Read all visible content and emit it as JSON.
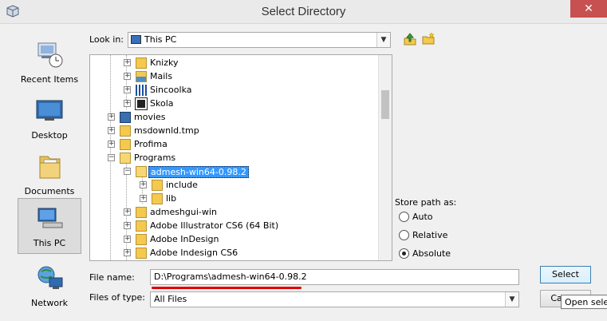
{
  "window": {
    "title": "Select Directory",
    "close_glyph": "✕"
  },
  "sidebar": {
    "items": [
      {
        "label": "Recent Items",
        "icon": "recent-items-icon"
      },
      {
        "label": "Desktop",
        "icon": "desktop-icon"
      },
      {
        "label": "Documents",
        "icon": "documents-icon"
      },
      {
        "label": "This PC",
        "icon": "this-pc-icon",
        "selected": true
      },
      {
        "label": "Network",
        "icon": "network-icon"
      }
    ]
  },
  "look_in": {
    "label": "Look in:",
    "value": "This PC"
  },
  "toolbar": {
    "up_icon": "up-folder-icon",
    "new_folder_icon": "new-folder-icon"
  },
  "tree": {
    "nodes": [
      {
        "label": "Knizky",
        "icon": "folder-icon"
      },
      {
        "label": "Mails",
        "icon": "mail-folder-icon"
      },
      {
        "label": "Sincoolka",
        "icon": "sincoolka-icon"
      },
      {
        "label": "Skola",
        "icon": "skola-icon"
      },
      {
        "label": "movies",
        "icon": "film-folder-icon"
      },
      {
        "label": "msdownld.tmp",
        "icon": "folder-icon"
      },
      {
        "label": "Profima",
        "icon": "folder-icon"
      },
      {
        "label": "Programs",
        "icon": "open-folder-icon"
      },
      {
        "label": "admesh-win64-0.98.2",
        "icon": "open-folder-icon",
        "selected": true
      },
      {
        "label": "include",
        "icon": "folder-icon"
      },
      {
        "label": "lib",
        "icon": "folder-icon"
      },
      {
        "label": "admeshgui-win",
        "icon": "folder-icon"
      },
      {
        "label": "Adobe Illustrator CS6 (64 Bit)",
        "icon": "folder-icon"
      },
      {
        "label": "Adobe InDesign",
        "icon": "folder-icon"
      },
      {
        "label": "Adobe Indesign CS6",
        "icon": "folder-icon"
      }
    ]
  },
  "store_path": {
    "label": "Store path as:",
    "options": [
      "Auto",
      "Relative",
      "Absolute"
    ],
    "selected": "Absolute"
  },
  "file_name": {
    "label": "File name:",
    "value": "D:\\Programs\\admesh-win64-0.98.2"
  },
  "files_of_type": {
    "label": "Files of type:",
    "value": "All Files"
  },
  "buttons": {
    "select": "Select",
    "cancel": "Cancel"
  },
  "tooltip": "Open selected directory",
  "colors": {
    "selection": "#3399ff",
    "annotation": "#e00000",
    "folder": "#f4c94e"
  }
}
